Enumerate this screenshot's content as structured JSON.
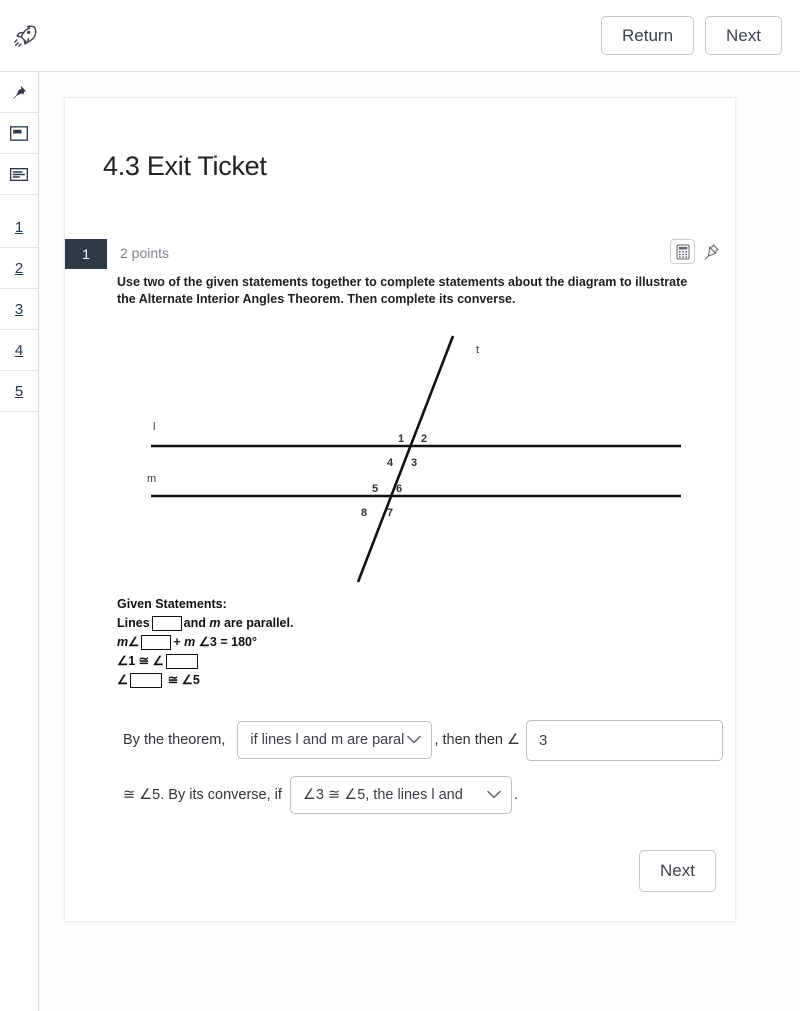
{
  "topbar": {
    "logo_icon": "rocket-icon",
    "return_label": "Return",
    "next_label": "Next"
  },
  "sidebar": {
    "icons": [
      {
        "name": "pin-icon"
      },
      {
        "name": "slide-icon"
      },
      {
        "name": "text-lines-icon"
      }
    ],
    "items": [
      {
        "label": "1"
      },
      {
        "label": "2"
      },
      {
        "label": "3"
      },
      {
        "label": "4"
      },
      {
        "label": "5"
      }
    ]
  },
  "card": {
    "title": "4.3 Exit Ticket",
    "question": {
      "number": "1",
      "points": "2 points",
      "calculator_icon": "calculator-icon",
      "pin_icon": "pin-icon",
      "prompt": "Use two of the given statements together to complete statements about the diagram to illustrate the Alternate Interior Angles Theorem. Then complete its converse."
    },
    "diagram": {
      "line_labels": {
        "top": "l",
        "bottom": "m",
        "transversal": "t"
      },
      "angles": [
        "1",
        "2",
        "4",
        "3",
        "5",
        "6",
        "8",
        "7"
      ]
    },
    "given": {
      "title": "Given Statements:",
      "line1_pre": "Lines",
      "line1_post_italic": "m",
      "line1_post": " are parallel.",
      "line1_and": "and ",
      "line2_pre_italic": "m",
      "line2_angle": "∠",
      "line2_mid": "+ ",
      "line2_mid_italic": "m",
      "line2_post": " ∠3 = 180°",
      "line3_pre": "∠1 ≅ ∠",
      "line4_pre": "∠",
      "line4_post": " ≅ ∠5"
    },
    "answer": {
      "lead_text": "By the theorem, ",
      "select1_value": "if lines l and m are paral",
      "mid_text": ", then then ∠",
      "input_value": "3",
      "second_lead": "≅ ∠5. By its converse, if",
      "select2_value": "∠3 ≅ ∠5, the lines l and",
      "period": ".",
      "chevron_icon": "chevron-down-icon"
    },
    "next_label": "Next"
  },
  "colors": {
    "badge_bg": "#2e3b47",
    "link": "#22384f",
    "border": "#c4c9cf",
    "muted_text": "#7b8289"
  }
}
